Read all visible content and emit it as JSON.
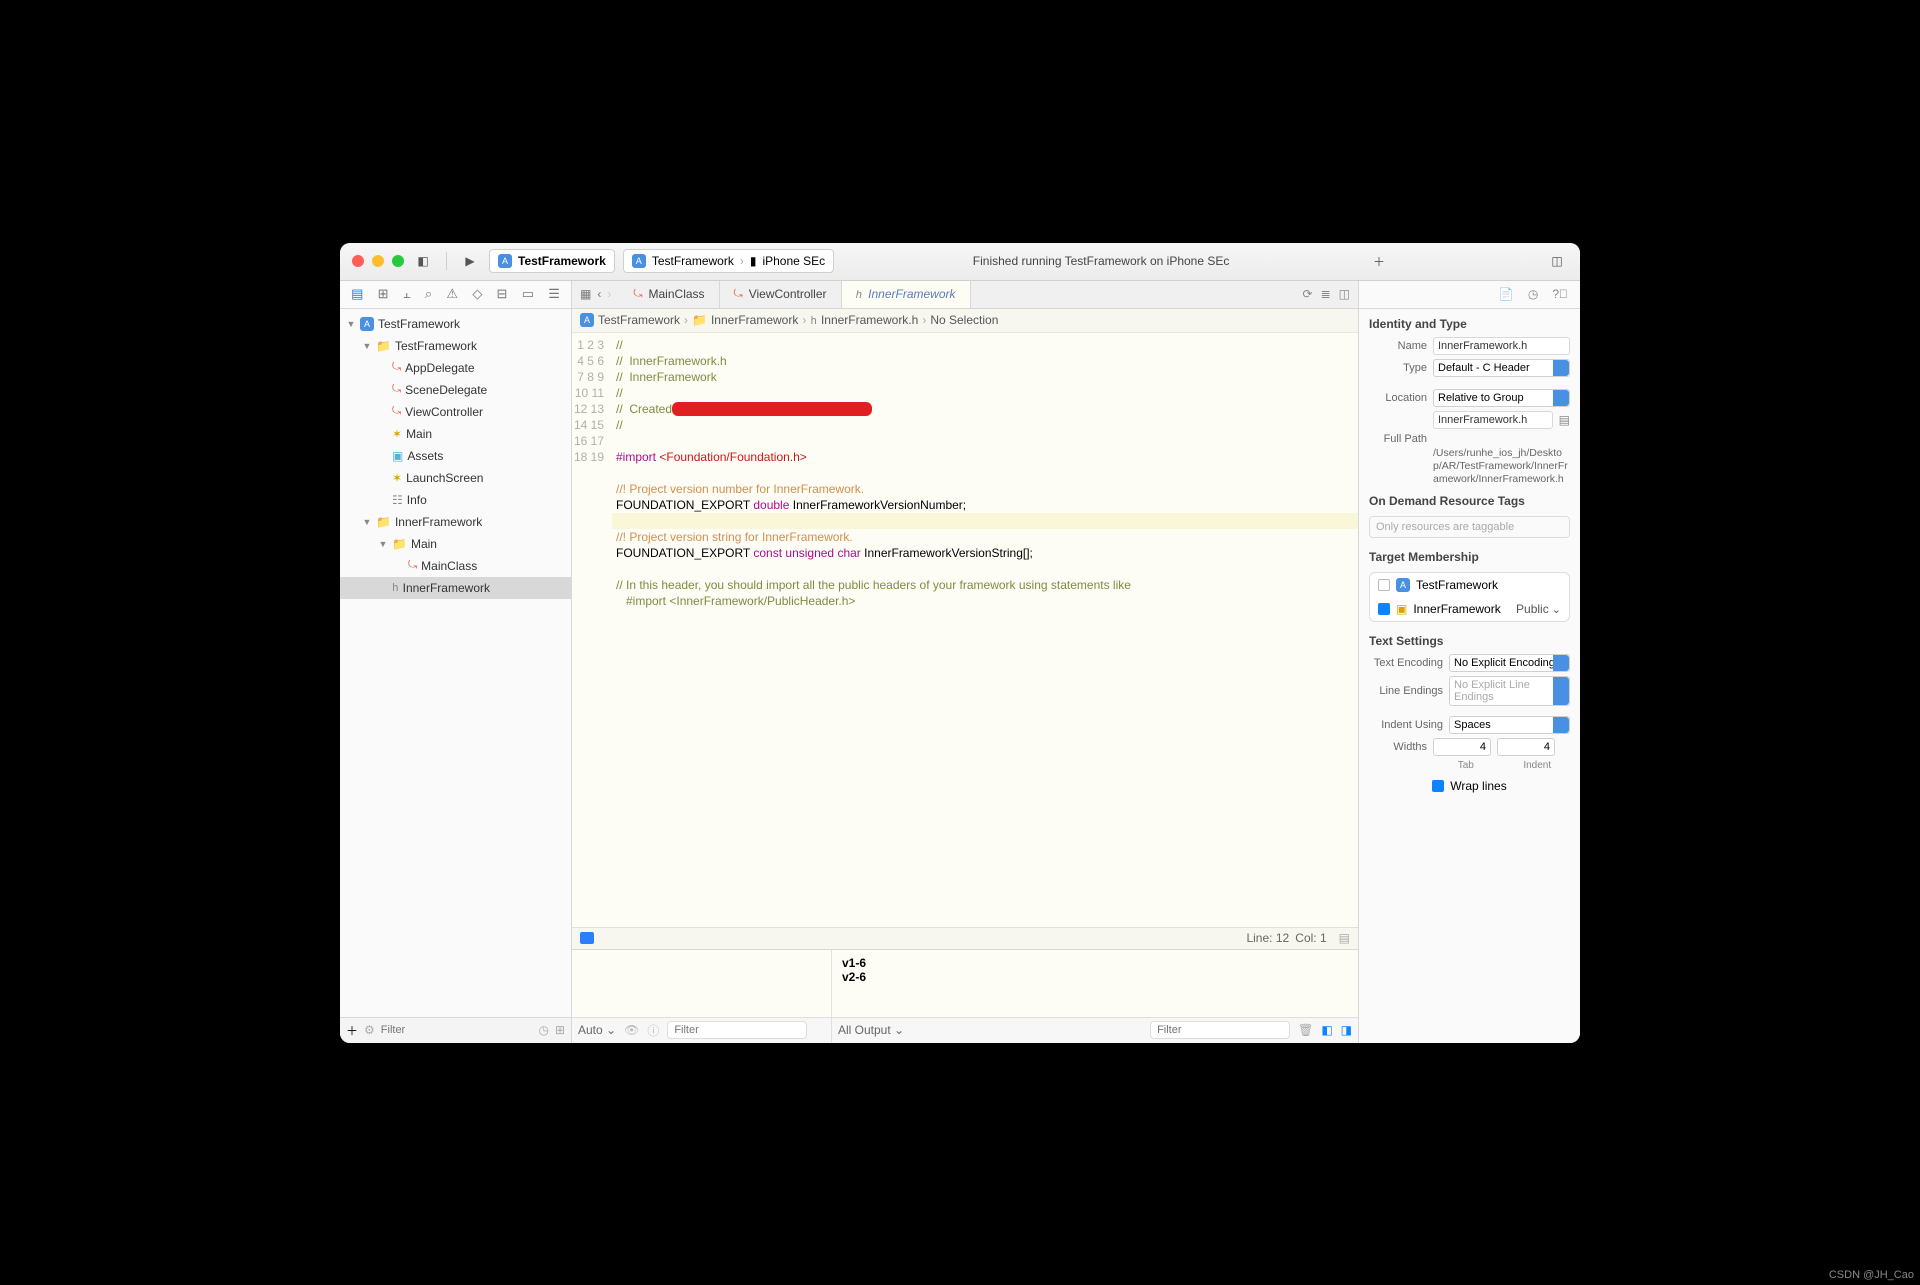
{
  "titlebar": {
    "scheme_project": "TestFramework",
    "scheme_sub": "TestFramework",
    "device": "iPhone SEc",
    "status": "Finished running TestFramework on iPhone SEc"
  },
  "navigator": {
    "root": "TestFramework",
    "group1": "TestFramework",
    "files1": [
      "AppDelegate",
      "SceneDelegate",
      "ViewController",
      "Main",
      "Assets",
      "LaunchScreen",
      "Info"
    ],
    "group2": "InnerFramework",
    "group2a": "Main",
    "files2": [
      "MainClass",
      "InnerFramework"
    ],
    "filter_placeholder": "Filter"
  },
  "tabs": {
    "t1": "MainClass",
    "t2": "ViewController",
    "t3": "InnerFramework"
  },
  "jumpbar": {
    "p1": "TestFramework",
    "p2": "InnerFramework",
    "p3": "InnerFramework.h",
    "p4": "No Selection"
  },
  "code": {
    "lines": [
      "//",
      "//  InnerFramework.h",
      "//  InnerFramework",
      "//",
      "//  Created",
      "//",
      "",
      "#import <Foundation/Foundation.h>",
      "",
      "//! Project version number for InnerFramework.",
      "FOUNDATION_EXPORT double InnerFrameworkVersionNumber;",
      "",
      "//! Project version string for InnerFramework.",
      "FOUNDATION_EXPORT const unsigned char InnerFrameworkVersionString[];",
      "",
      "// In this header, you should import all the public headers of your framework using statements like",
      "   #import <InnerFramework/PublicHeader.h>",
      "",
      ""
    ]
  },
  "status": {
    "line": "Line: 12",
    "col": "Col: 1"
  },
  "debug": {
    "out1": "v1-6",
    "out2": " v2-6",
    "auto": "Auto",
    "all_output": "All Output",
    "filter": "Filter"
  },
  "inspector": {
    "identity": "Identity and Type",
    "name_label": "Name",
    "name_value": "InnerFramework.h",
    "type_label": "Type",
    "type_value": "Default - C Header",
    "location_label": "Location",
    "location_value": "Relative to Group",
    "location_path": "InnerFramework.h",
    "fullpath_label": "Full Path",
    "fullpath_value": "/Users/runhe_ios_jh/Desktop/AR/TestFramework/InnerFramework/InnerFramework.h",
    "ondemand": "On Demand Resource Tags",
    "ondemand_placeholder": "Only resources are taggable",
    "membership": "Target Membership",
    "mem1": "TestFramework",
    "mem2": "InnerFramework",
    "mem2_vis": "Public",
    "textsettings": "Text Settings",
    "encoding_label": "Text Encoding",
    "encoding_value": "No Explicit Encoding",
    "lineend_label": "Line Endings",
    "lineend_value": "No Explicit Line Endings",
    "indent_label": "Indent Using",
    "indent_value": "Spaces",
    "widths_label": "Widths",
    "tab_val": "4",
    "indent_val": "4",
    "tab_l": "Tab",
    "indent_l": "Indent",
    "wrap": "Wrap lines"
  },
  "watermark": "CSDN @JH_Cao"
}
